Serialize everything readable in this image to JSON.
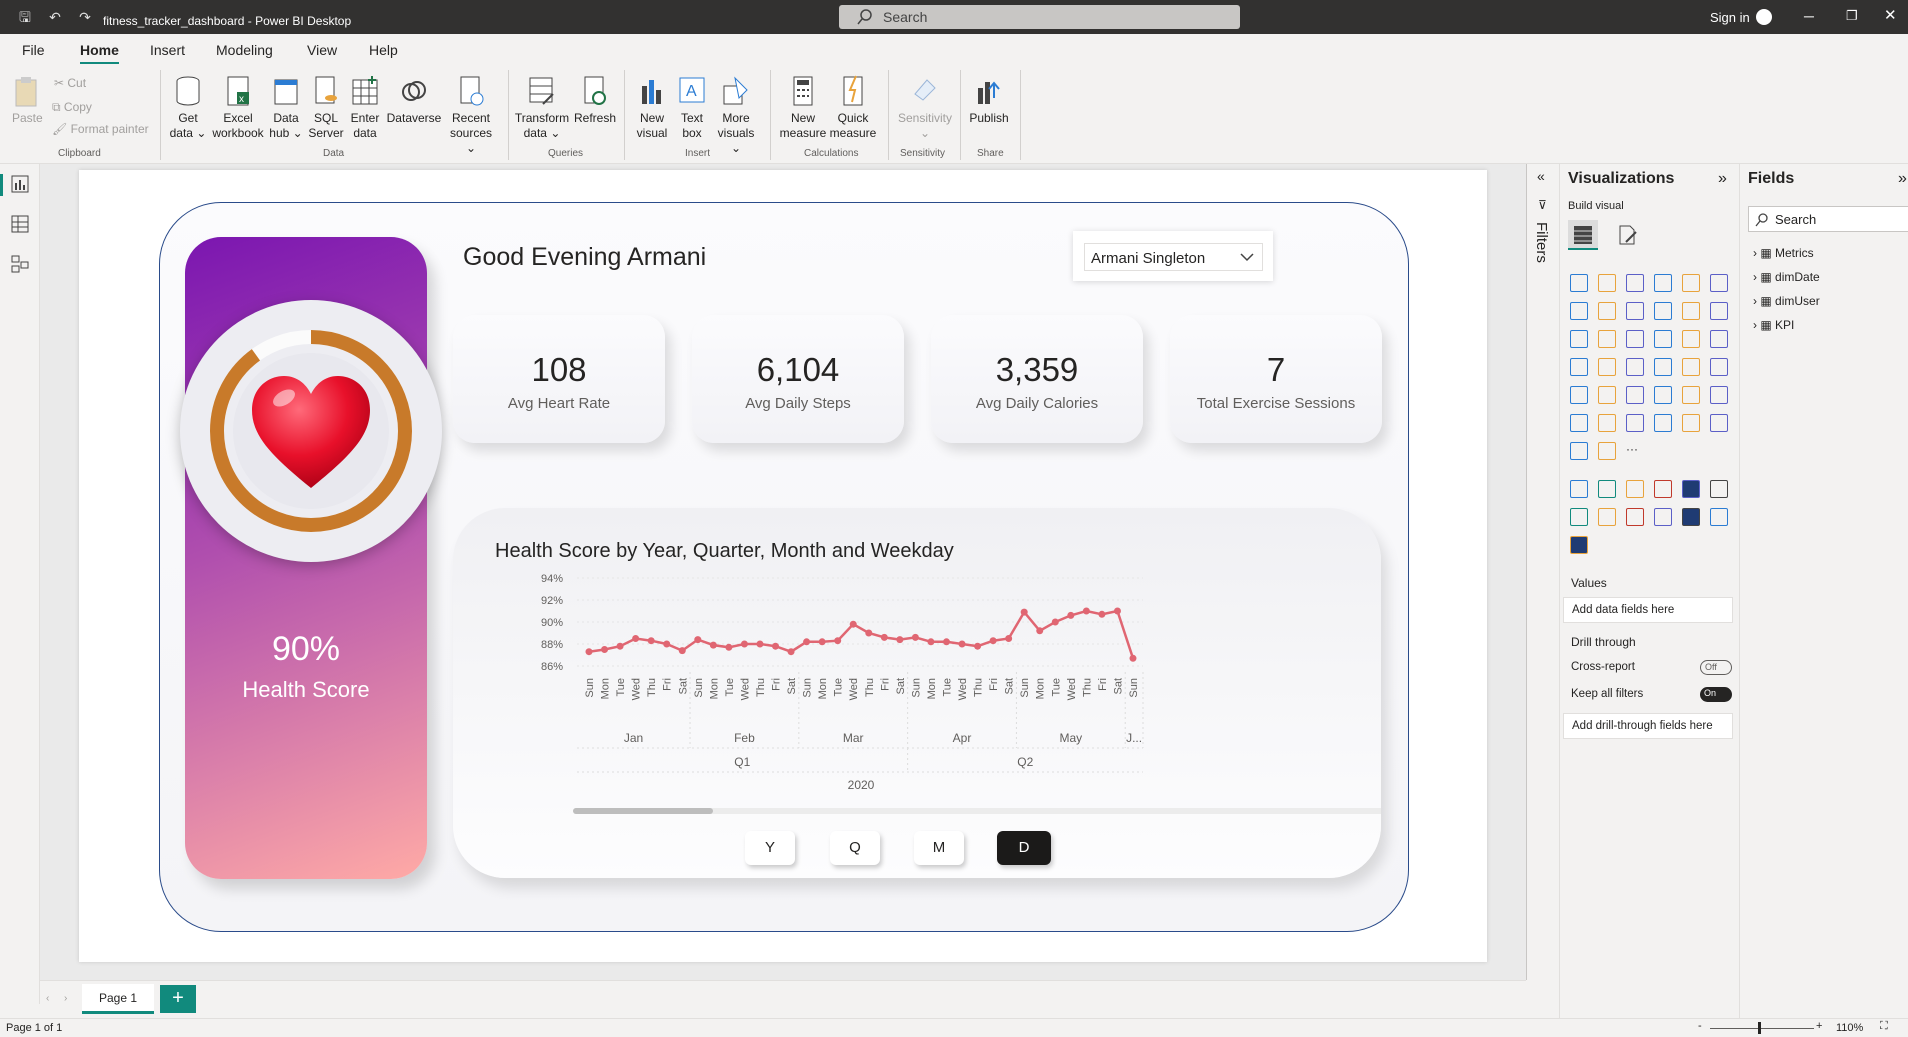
{
  "app": {
    "title": "fitness_tracker_dashboard - Power BI Desktop",
    "search_placeholder": "Search",
    "sign_in": "Sign in"
  },
  "menu": [
    "File",
    "Home",
    "Insert",
    "Modeling",
    "View",
    "Help"
  ],
  "ribbon": {
    "clipboard": {
      "paste": "Paste",
      "cut": "Cut",
      "copy": "Copy",
      "format_painter": "Format painter",
      "group": "Clipboard"
    },
    "data": [
      {
        "l1": "Get",
        "l2": "data ⌄"
      },
      {
        "l1": "Excel",
        "l2": "workbook"
      },
      {
        "l1": "Data",
        "l2": "hub ⌄"
      },
      {
        "l1": "SQL",
        "l2": "Server"
      },
      {
        "l1": "Enter",
        "l2": "data"
      },
      {
        "l1": "Dataverse",
        "l2": ""
      },
      {
        "l1": "Recent",
        "l2": "sources ⌄"
      }
    ],
    "data_group": "Data",
    "queries": [
      {
        "l1": "Transform",
        "l2": "data ⌄"
      },
      {
        "l1": "Refresh",
        "l2": ""
      }
    ],
    "queries_group": "Queries",
    "insert": [
      {
        "l1": "New",
        "l2": "visual"
      },
      {
        "l1": "Text",
        "l2": "box"
      },
      {
        "l1": "More",
        "l2": "visuals ⌄"
      }
    ],
    "insert_group": "Insert",
    "calculations": [
      {
        "l1": "New",
        "l2": "measure"
      },
      {
        "l1": "Quick",
        "l2": "measure"
      }
    ],
    "calculations_group": "Calculations",
    "sensitivity": {
      "label": "Sensitivity",
      "group": "Sensitivity"
    },
    "share": {
      "label": "Publish",
      "group": "Share"
    }
  },
  "report": {
    "greeting": "Good Evening Armani",
    "user_select": "Armani Singleton",
    "health_score_value": "90%",
    "health_score_label": "Health Score",
    "health_score_fraction": 0.9,
    "kpis": [
      {
        "value": "108",
        "label": "Avg Heart Rate"
      },
      {
        "value": "6,104",
        "label": "Avg Daily Steps"
      },
      {
        "value": "3,359",
        "label": "Avg Daily Calories"
      },
      {
        "value": "7",
        "label": "Total Exercise Sessions"
      }
    ],
    "period_buttons": [
      "Y",
      "Q",
      "M",
      "D"
    ],
    "active_period": "D"
  },
  "chart_data": {
    "type": "line",
    "title": "Health Score by Year, Quarter, Month and Weekday",
    "x": [
      "Sun",
      "Mon",
      "Tue",
      "Wed",
      "Thu",
      "Fri",
      "Sat",
      "Sun",
      "Mon",
      "Tue",
      "Wed",
      "Thu",
      "Fri",
      "Sat",
      "Sun",
      "Mon",
      "Tue",
      "Wed",
      "Thu",
      "Fri",
      "Sat",
      "Sun",
      "Mon",
      "Tue",
      "Wed",
      "Thu",
      "Fri",
      "Sat",
      "Sun",
      "Mon",
      "Tue",
      "Wed",
      "Thu",
      "Fri",
      "Sat",
      "Sun"
    ],
    "months": [
      {
        "label": "Jan",
        "span": 7
      },
      {
        "label": "Feb",
        "span": 7
      },
      {
        "label": "Mar",
        "span": 7
      },
      {
        "label": "Apr",
        "span": 7
      },
      {
        "label": "May",
        "span": 7
      },
      {
        "label": "J...",
        "span": 1
      }
    ],
    "quarters": [
      {
        "label": "Q1",
        "span": 21
      },
      {
        "label": "Q2",
        "span": 15
      }
    ],
    "year": "2020",
    "values": [
      87.3,
      87.5,
      87.8,
      88.5,
      88.3,
      88.0,
      87.4,
      88.4,
      87.9,
      87.7,
      88.0,
      88.0,
      87.8,
      87.3,
      88.2,
      88.2,
      88.3,
      89.8,
      89.0,
      88.6,
      88.4,
      88.6,
      88.2,
      88.2,
      88.0,
      87.8,
      88.3,
      88.5,
      90.9,
      89.2,
      90.0,
      90.6,
      91.0,
      90.7,
      91.0,
      86.7
    ],
    "yticks": [
      "94%",
      "92%",
      "90%",
      "88%",
      "86%"
    ],
    "ylim": [
      86,
      94
    ],
    "color": "#e06672"
  },
  "pages": {
    "tab": "Page 1",
    "status": "Page 1 of 1",
    "zoom": "110%"
  },
  "filters": {
    "label": "Filters"
  },
  "visualizations": {
    "title": "Visualizations",
    "build_visual": "Build visual",
    "values": "Values",
    "values_well": "Add data fields here",
    "drill_through": "Drill through",
    "cross_report": "Cross-report",
    "cross_report_state": "Off",
    "keep_filters": "Keep all filters",
    "keep_filters_state": "On",
    "drill_well": "Add drill-through fields here"
  },
  "fields": {
    "title": "Fields",
    "search_placeholder": "Search",
    "tables": [
      "Metrics",
      "dimDate",
      "dimUser",
      "KPI"
    ]
  },
  "colors": {
    "accent": "#118a7d",
    "ring": "#c87a2a",
    "frame": "#2a4b8a"
  }
}
